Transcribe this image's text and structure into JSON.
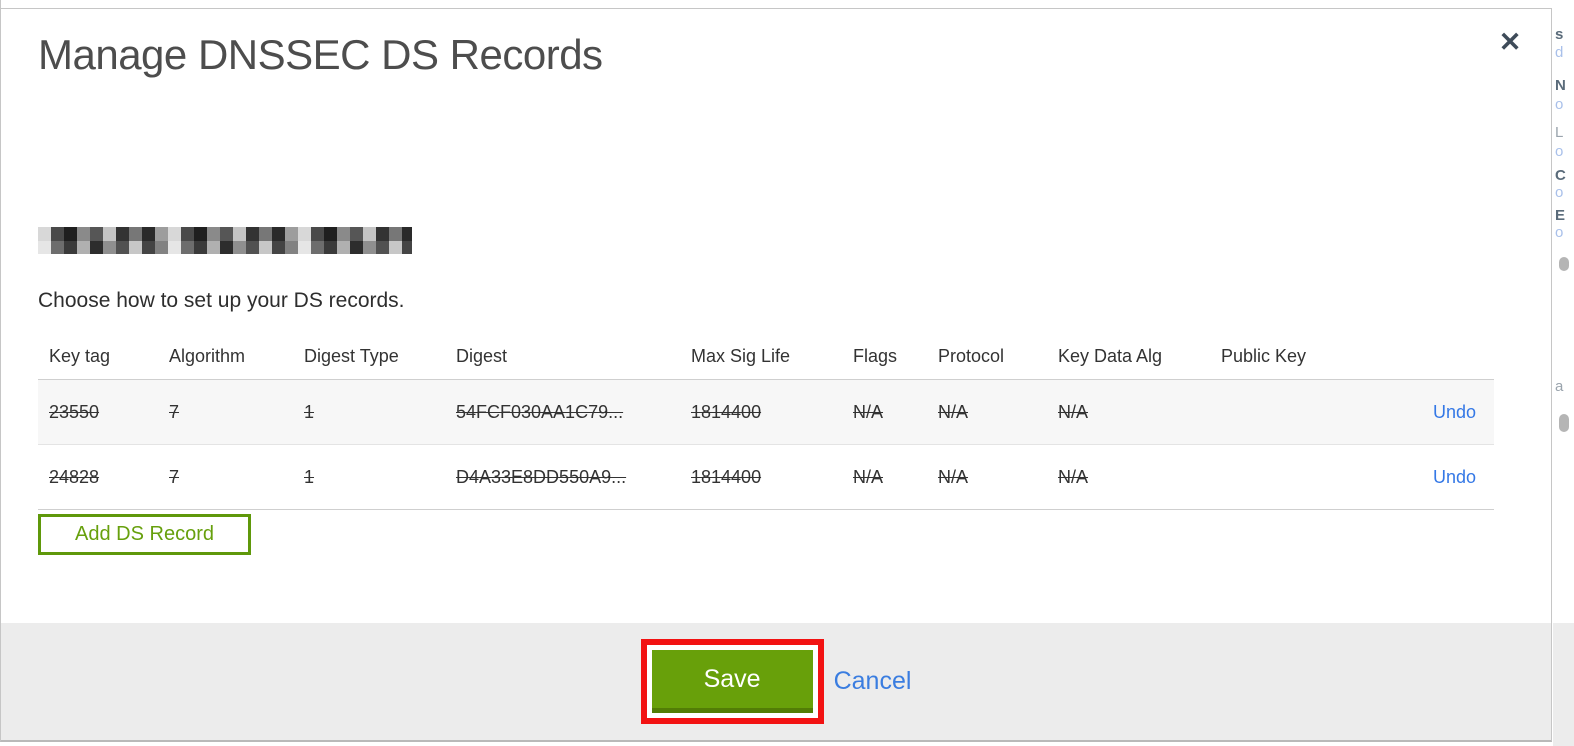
{
  "dialog": {
    "title": "Manage DNSSEC DS Records",
    "close_icon": "✕",
    "intro": "Choose how to set up your DS records.",
    "add_record_label": "Add DS Record"
  },
  "table": {
    "columns": {
      "key_tag": "Key tag",
      "algorithm": "Algorithm",
      "digest_type": "Digest Type",
      "digest": "Digest",
      "max_sig_life": "Max Sig Life",
      "flags": "Flags",
      "protocol": "Protocol",
      "key_data_alg": "Key Data Alg",
      "public_key": "Public Key"
    },
    "rows": [
      {
        "key_tag": "23550",
        "algorithm": "7",
        "digest_type": "1",
        "digest": "54FCF030AA1C79...",
        "max_sig_life": "1814400",
        "flags": "N/A",
        "protocol": "N/A",
        "key_data_alg": "N/A",
        "public_key": "",
        "action": "Undo",
        "state": "marked-for-deletion"
      },
      {
        "key_tag": "24828",
        "algorithm": "7",
        "digest_type": "1",
        "digest": "D4A33E8DD550A9...",
        "max_sig_life": "1814400",
        "flags": "N/A",
        "protocol": "N/A",
        "key_data_alg": "N/A",
        "public_key": "",
        "action": "Undo",
        "state": "marked-for-deletion"
      }
    ]
  },
  "footer": {
    "save_label": "Save",
    "cancel_label": "Cancel"
  },
  "annotation": {
    "type": "highlight-rectangle",
    "target": "save-button",
    "color": "#f21212"
  },
  "colors": {
    "primary_button_green": "#68a00a",
    "primary_button_green_dark": "#527d06",
    "outline_button_green": "#5f980a",
    "link_blue": "#3a7de0",
    "footer_gray": "#ececec",
    "row_stripe": "#f7f7f7"
  },
  "edge": {
    "fragments": [
      {
        "char": "s"
      },
      {
        "char": "d"
      },
      {
        "char": "N"
      },
      {
        "char": "o"
      },
      {
        "char": "L"
      },
      {
        "char": "o"
      },
      {
        "char": "C"
      },
      {
        "char": "o"
      },
      {
        "char": "E"
      },
      {
        "char": "o"
      },
      {
        "char": "a"
      }
    ]
  }
}
